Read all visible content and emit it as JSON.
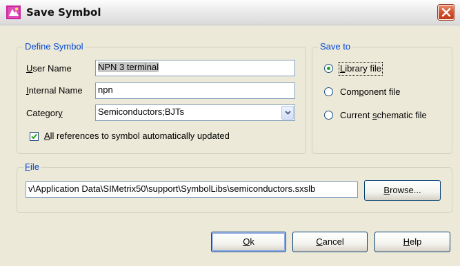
{
  "window": {
    "title": "Save Symbol"
  },
  "define_symbol": {
    "legend": "Define Symbol",
    "user_name_label_mnemonic": "U",
    "user_name_label_rest": "ser Name",
    "user_name_value": "NPN 3 terminal",
    "internal_name_label_mnemonic": "I",
    "internal_name_label_rest": "nternal Name",
    "internal_name_value": "npn",
    "category_label_prefix": "Categor",
    "category_label_mnemonic": "y",
    "category_value": "Semiconductors;BJTs",
    "auto_update_checked": true,
    "auto_update_label_mnemonic": "A",
    "auto_update_label_rest": "ll references to symbol automatically updated"
  },
  "save_to": {
    "legend": "Save to",
    "options": [
      {
        "prefix": "",
        "mnemonic": "L",
        "rest": "ibrary file",
        "selected": true
      },
      {
        "prefix": "Com",
        "mnemonic": "p",
        "rest": "onent file",
        "selected": false
      },
      {
        "prefix": "Current ",
        "mnemonic": "s",
        "rest": "chematic file",
        "selected": false
      }
    ]
  },
  "file": {
    "legend_mnemonic": "F",
    "legend_rest": "ile",
    "path": "v\\Application Data\\SIMetrix50\\support\\SymbolLibs\\semiconductors.sxslb",
    "browse_mnemonic": "B",
    "browse_rest": "rowse..."
  },
  "buttons": {
    "ok_mnemonic": "O",
    "ok_rest": "k",
    "cancel_mnemonic": "C",
    "cancel_rest": "ancel",
    "help_mnemonic": "H",
    "help_rest": "elp"
  },
  "colors": {
    "legend": "#0046d5",
    "dialog_bg": "#ece9d8",
    "radio_selected": "#21a121",
    "check_mark": "#21a121"
  },
  "icons": {
    "app": "symbol-app-icon",
    "close": "close-icon",
    "combo": "chevron-down-icon",
    "check": "check-icon"
  }
}
